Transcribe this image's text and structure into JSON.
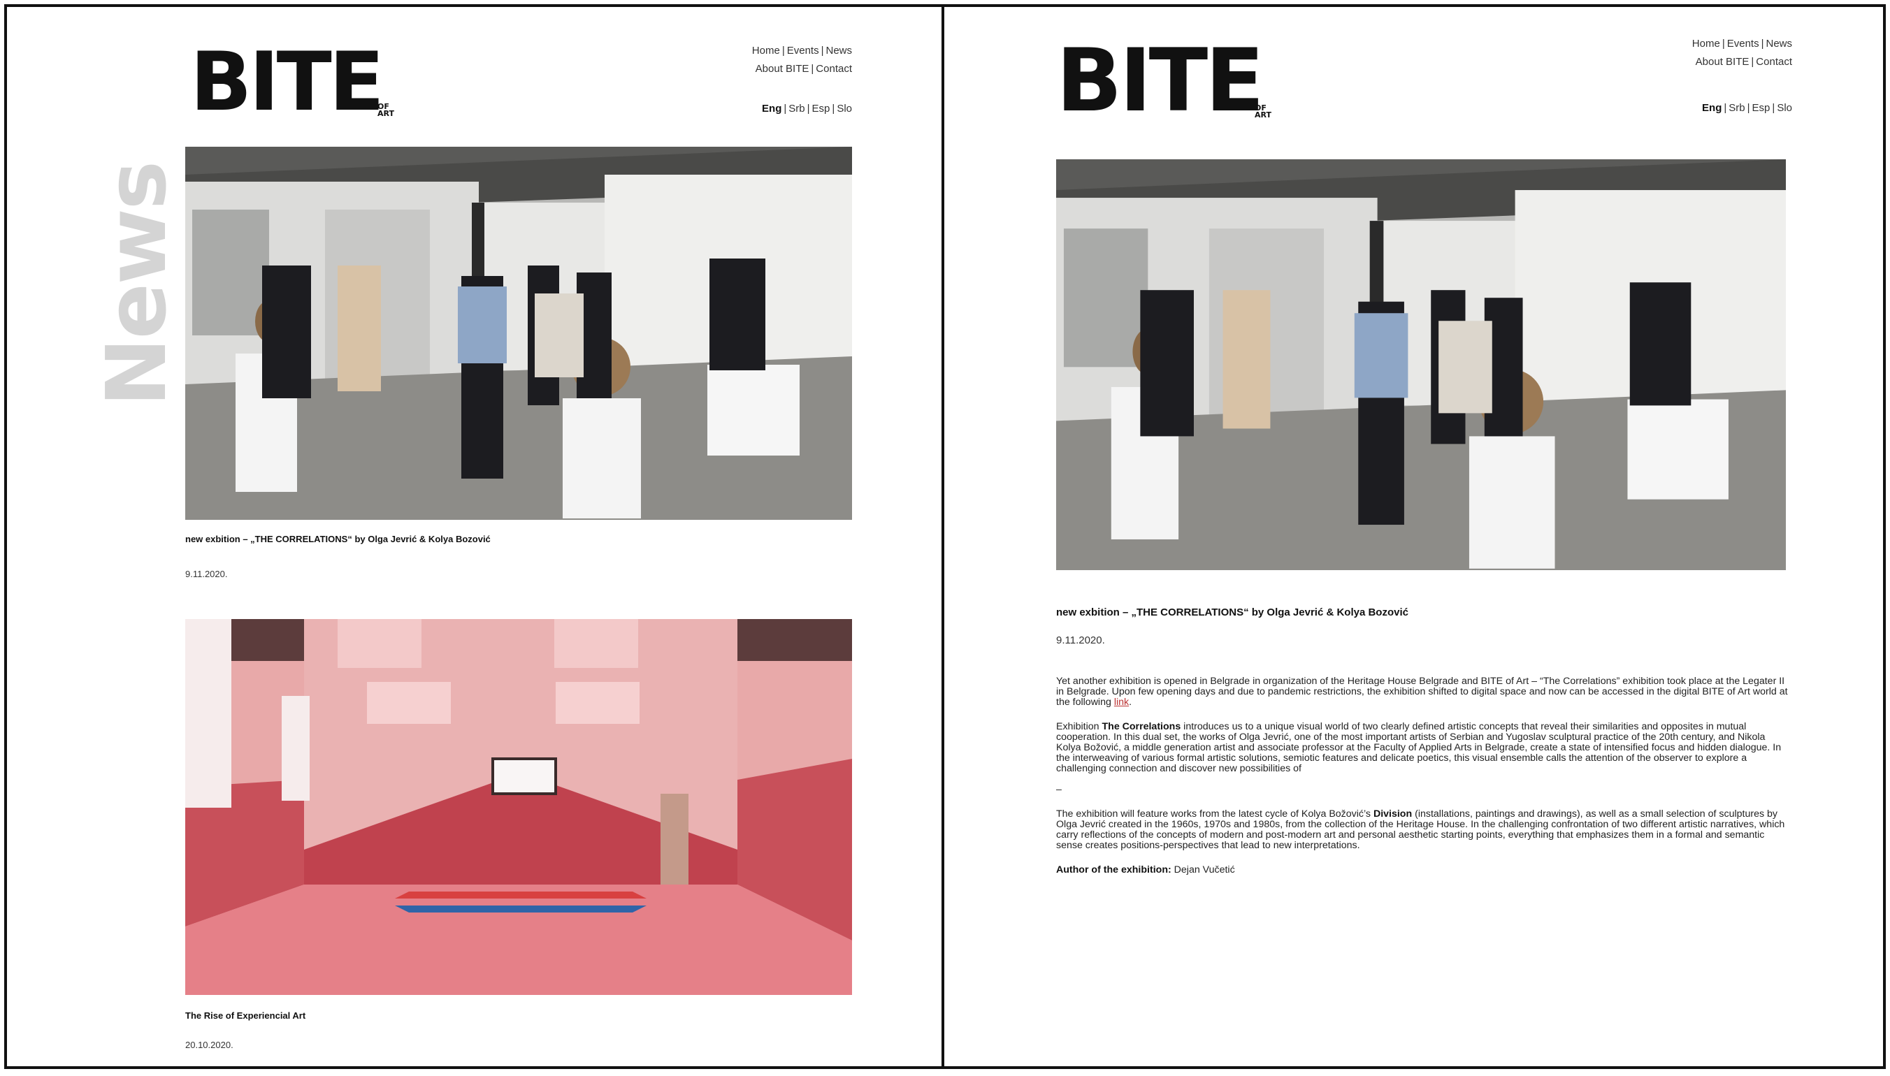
{
  "site": {
    "logo_text": "BITE",
    "logo_sub": "OF ART"
  },
  "nav": {
    "home": "Home",
    "events": "Events",
    "news": "News",
    "about": "About BITE",
    "contact": "Contact"
  },
  "lang": {
    "eng": "Eng",
    "srb": "Srb",
    "esp": "Esp",
    "slo": "Slo"
  },
  "left_page": {
    "section_label": "News",
    "posts": [
      {
        "title": "new exbition – „THE CORRELATIONS“ by Olga Jevrić & Kolya Bozović",
        "date": "9.11.2020.",
        "image_icon": "gallery-photo"
      },
      {
        "title": "The Rise of Experiencial Art",
        "date": "20.10.2020.",
        "image_icon": "gym-photo"
      }
    ]
  },
  "right_page": {
    "title": "new exbition – „THE CORRELATIONS“ by Olga Jevrić & Kolya Bozović",
    "date": "9.11.2020.",
    "p1": "Yet another exhibition is opened in Belgrade in organization of the Heritage House Belgrade and BITE of Art – “The Correlations” exhibition took place at the Legater II in Belgrade. Upon few opening days and due to pandemic restrictions, the exhibition shifted to digital space and now can be accessed in the digital BITE of Art world at the following",
    "p1_link": "link",
    "p1_end": ".",
    "p2_start": "Exhibition",
    "p2_bold": "The Correlations",
    "p2_rest": "introduces us to a unique visual world of two clearly defined artistic concepts that reveal their similarities and opposites in mutual cooperation. In this dual set, the works of Olga Jevrić, one of the most important artists of Serbian and Yugoslav sculptural practice of the 20th century, and Nikola Kolya Božović, a middle generation artist and associate professor at the Faculty of Applied Arts in Belgrade, create a state of intensified focus and hidden dialogue. In the interweaving of various formal artistic solutions, semiotic features and delicate poetics, this visual ensemble calls the attention of the observer to explore a challenging connection and discover new possibilities of",
    "p2_dash": "–",
    "p3_start": "The exhibition will feature works from the latest cycle of Kolya Božović’s",
    "p3_bold": "Division",
    "p3_rest": "(installations, paintings and drawings), as well as a small selection of sculptures by Olga Jevrić created in the 1960s, 1970s and 1980s, from the collection of the Heritage House. In the challenging confrontation of two different artistic narratives, which carry reflections of the concepts of modern and post-modern art and personal aesthetic starting points, everything that emphasizes them in a formal and semantic sense creates positions-perspectives that lead to new interpretations.",
    "author_label": "Author of the exhibition:",
    "author_name": "Dejan Vučetić"
  },
  "colors": {
    "brand_black": "#111111",
    "news_label_gray": "#d4d4d4",
    "link_red": "#b33333",
    "gym_pink": "#e8a9a9",
    "gym_red": "#c8505a"
  }
}
